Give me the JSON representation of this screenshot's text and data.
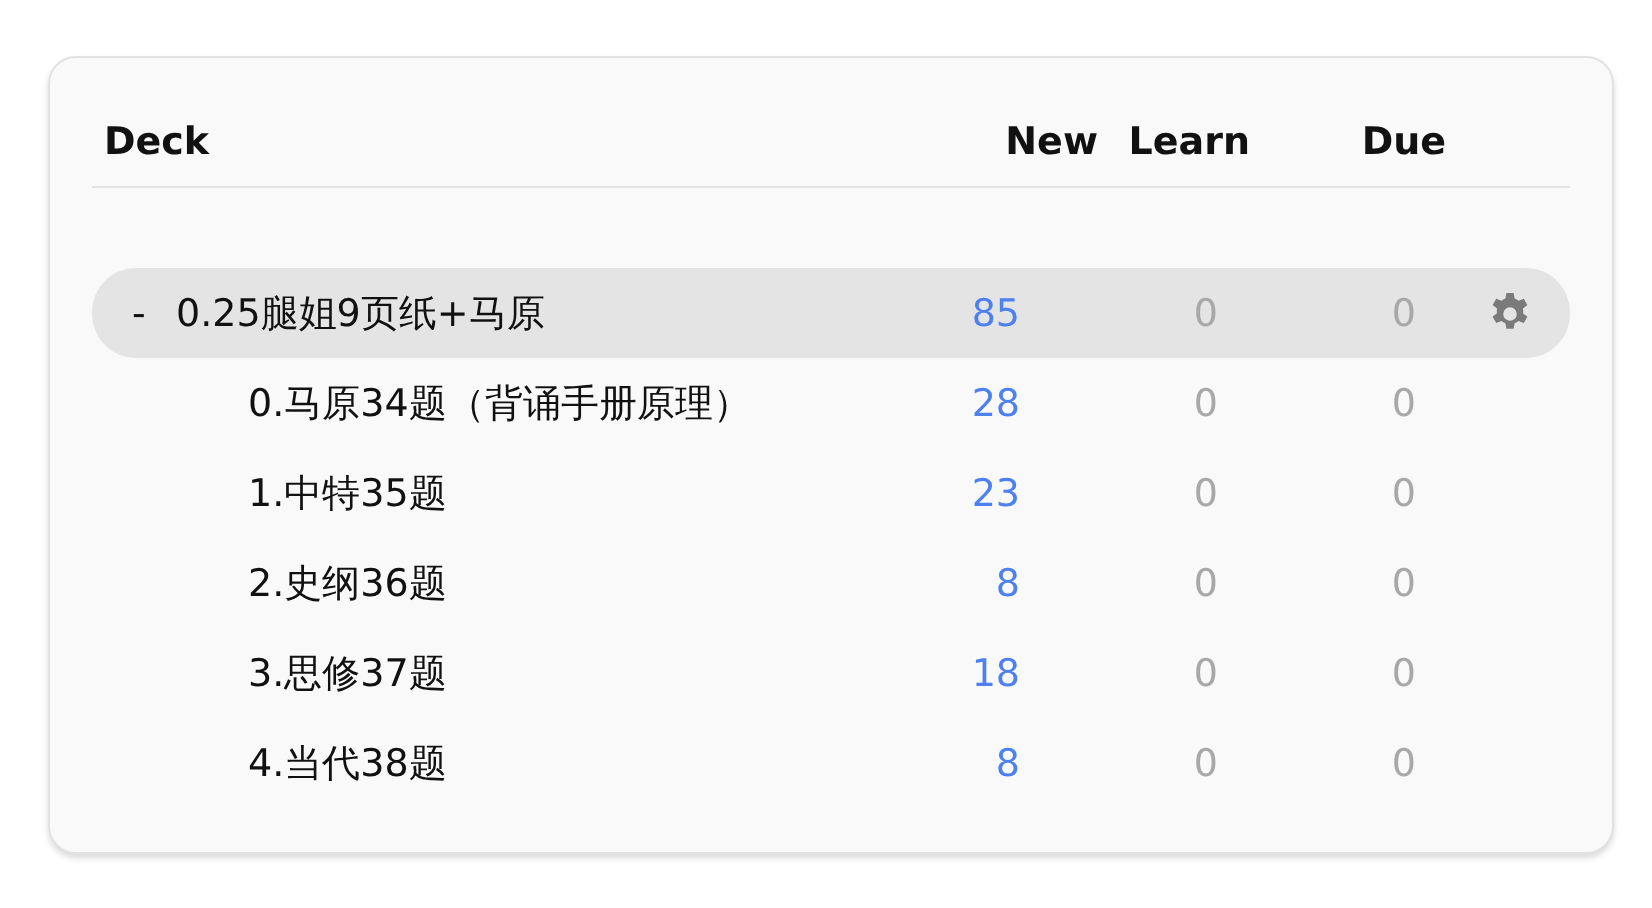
{
  "header": {
    "deck": "Deck",
    "new": "New",
    "learn": "Learn",
    "due": "Due"
  },
  "decks": [
    {
      "name": "0.25腿姐9页纸+马原",
      "toggle": "-",
      "expanded": true,
      "current": true,
      "new": "85",
      "learn": "0",
      "due": "0",
      "children": [
        {
          "name": "0.马原34题（背诵手册原理）",
          "current": false,
          "new": "28",
          "learn": "0",
          "due": "0"
        },
        {
          "name": "1.中特35题",
          "current": false,
          "new": "23",
          "learn": "0",
          "due": "0"
        },
        {
          "name": "2.史纲36题",
          "current": false,
          "new": "8",
          "learn": "0",
          "due": "0"
        },
        {
          "name": "3.思修37题",
          "current": false,
          "new": "18",
          "learn": "0",
          "due": "0"
        },
        {
          "name": "4.当代38题",
          "current": false,
          "new": "8",
          "learn": "0",
          "due": "0"
        }
      ]
    }
  ]
}
